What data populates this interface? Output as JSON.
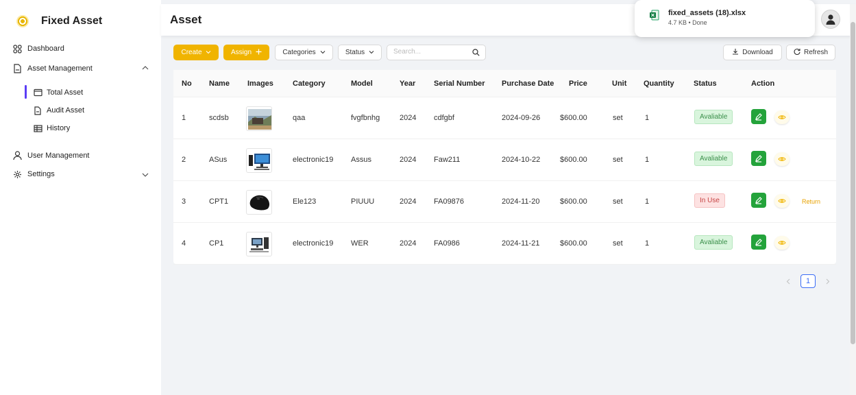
{
  "app": {
    "title": "Fixed Asset"
  },
  "sidebar": {
    "items": [
      {
        "label": "Dashboard",
        "icon": "grid-icon"
      },
      {
        "label": "Asset Management",
        "icon": "document-icon"
      },
      {
        "label": "User Management",
        "icon": "user-icon"
      },
      {
        "label": "Settings",
        "icon": "gear-icon"
      }
    ],
    "sub_items": [
      {
        "label": "Total Asset",
        "icon": "mail-icon",
        "active": true
      },
      {
        "label": "Audit Asset",
        "icon": "document-icon"
      },
      {
        "label": "History",
        "icon": "table-icon"
      }
    ]
  },
  "header": {
    "title": "Asset"
  },
  "download": {
    "file_name": "fixed_assets (18).xlsx",
    "meta": "4.7 KB • Done",
    "icon": "excel-icon"
  },
  "toolbar": {
    "create_label": "Create",
    "assign_label": "Assign",
    "categories_label": "Categories",
    "status_label": "Status",
    "search_placeholder": "Search...",
    "download_label": "Download",
    "refresh_label": "Refresh"
  },
  "colors": {
    "accent": "#f0b400",
    "active": "#5b3df5",
    "edit": "#24a33b",
    "link": "#e8a200"
  },
  "table": {
    "columns": [
      "No",
      "Name",
      "Images",
      "Category",
      "Model",
      "Year",
      "Serial Number",
      "Purchase Date",
      "Price",
      "Unit",
      "Quantity",
      "Status",
      "Action"
    ],
    "rows": [
      {
        "no": "1",
        "name": "scdsb",
        "image": "landscape-photo",
        "category": "qaa",
        "model": "fvgfbnhg",
        "year": "2024",
        "serial": "cdfgbf",
        "purchase_date": "2024-09-26",
        "price": "$600.00",
        "unit": "set",
        "quantity": "1",
        "status": "Avaliable"
      },
      {
        "no": "2",
        "name": "ASus",
        "image": "desktop-computer-photo",
        "category": "electronic19",
        "model": "Assus",
        "year": "2024",
        "serial": "Faw211",
        "purchase_date": "2024-10-22",
        "price": "$600.00",
        "unit": "set",
        "quantity": "1",
        "status": "Avaliable"
      },
      {
        "no": "3",
        "name": "CPT1",
        "image": "computer-mouse-photo",
        "category": "Ele123",
        "model": "PIUUU",
        "year": "2024",
        "serial": "FA09876",
        "purchase_date": "2024-11-20",
        "price": "$600.00",
        "unit": "set",
        "quantity": "1",
        "status": "In Use",
        "action_link": "Return"
      },
      {
        "no": "4",
        "name": "CP1",
        "image": "computer-set-photo",
        "category": "electronic19",
        "model": "WER",
        "year": "2024",
        "serial": "FA0986",
        "purchase_date": "2024-11-21",
        "price": "$600.00",
        "unit": "set",
        "quantity": "1",
        "status": "Avaliable"
      }
    ]
  },
  "pagination": {
    "current": "1"
  }
}
